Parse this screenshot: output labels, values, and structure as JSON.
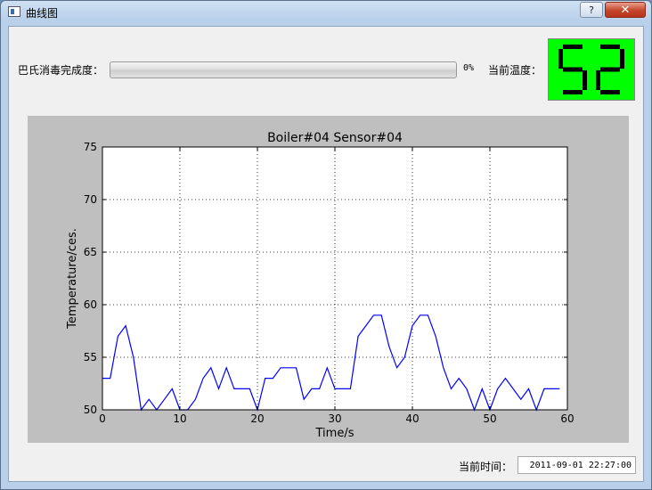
{
  "window": {
    "title": "曲线图",
    "help_label": "?",
    "close_label": "✕"
  },
  "status": {
    "progress_label": "巴氏消毒完成度：",
    "progress_percent": 0,
    "progress_text": "0%",
    "temp_label": "当前温度：",
    "temp_value": "52",
    "lcd_color": "#00ff00",
    "time_label": "当前时间：",
    "time_value": "2011-09-01 22:27:00"
  },
  "chart_data": {
    "type": "line",
    "title": "Boiler#04 Sensor#04",
    "xlabel": "Time/s",
    "ylabel": "Temperature/ces.",
    "xlim": [
      0,
      60
    ],
    "ylim": [
      50,
      75
    ],
    "xticks": [
      0,
      10,
      20,
      30,
      40,
      50,
      60
    ],
    "yticks": [
      50,
      55,
      60,
      65,
      70,
      75
    ],
    "grid": true,
    "line_color": "#0000ff",
    "series": [
      {
        "x": [
          0,
          1,
          2,
          3,
          4,
          5,
          6,
          7,
          8,
          9,
          10,
          11,
          12,
          13,
          14,
          15,
          16,
          17,
          18,
          19,
          20,
          21,
          22,
          23,
          24,
          25,
          26,
          27,
          28,
          29,
          30,
          31,
          32,
          33,
          34,
          35,
          36,
          37,
          38,
          39,
          40,
          41,
          42,
          43,
          44,
          45,
          46,
          47,
          48,
          49,
          50,
          51,
          52,
          53,
          54,
          55,
          56,
          57,
          58,
          59
        ],
        "values": [
          53,
          53,
          57,
          58,
          55,
          50,
          51,
          50,
          51,
          52,
          50,
          50,
          51,
          53,
          54,
          52,
          54,
          52,
          52,
          52,
          50,
          53,
          53,
          54,
          54,
          54,
          51,
          52,
          52,
          54,
          52,
          52,
          52,
          57,
          58,
          59,
          59,
          56,
          54,
          55,
          58,
          59,
          59,
          57,
          54,
          52,
          53,
          52,
          50,
          52,
          50,
          52,
          53,
          52,
          51,
          52,
          50,
          52,
          52,
          52
        ]
      }
    ]
  }
}
